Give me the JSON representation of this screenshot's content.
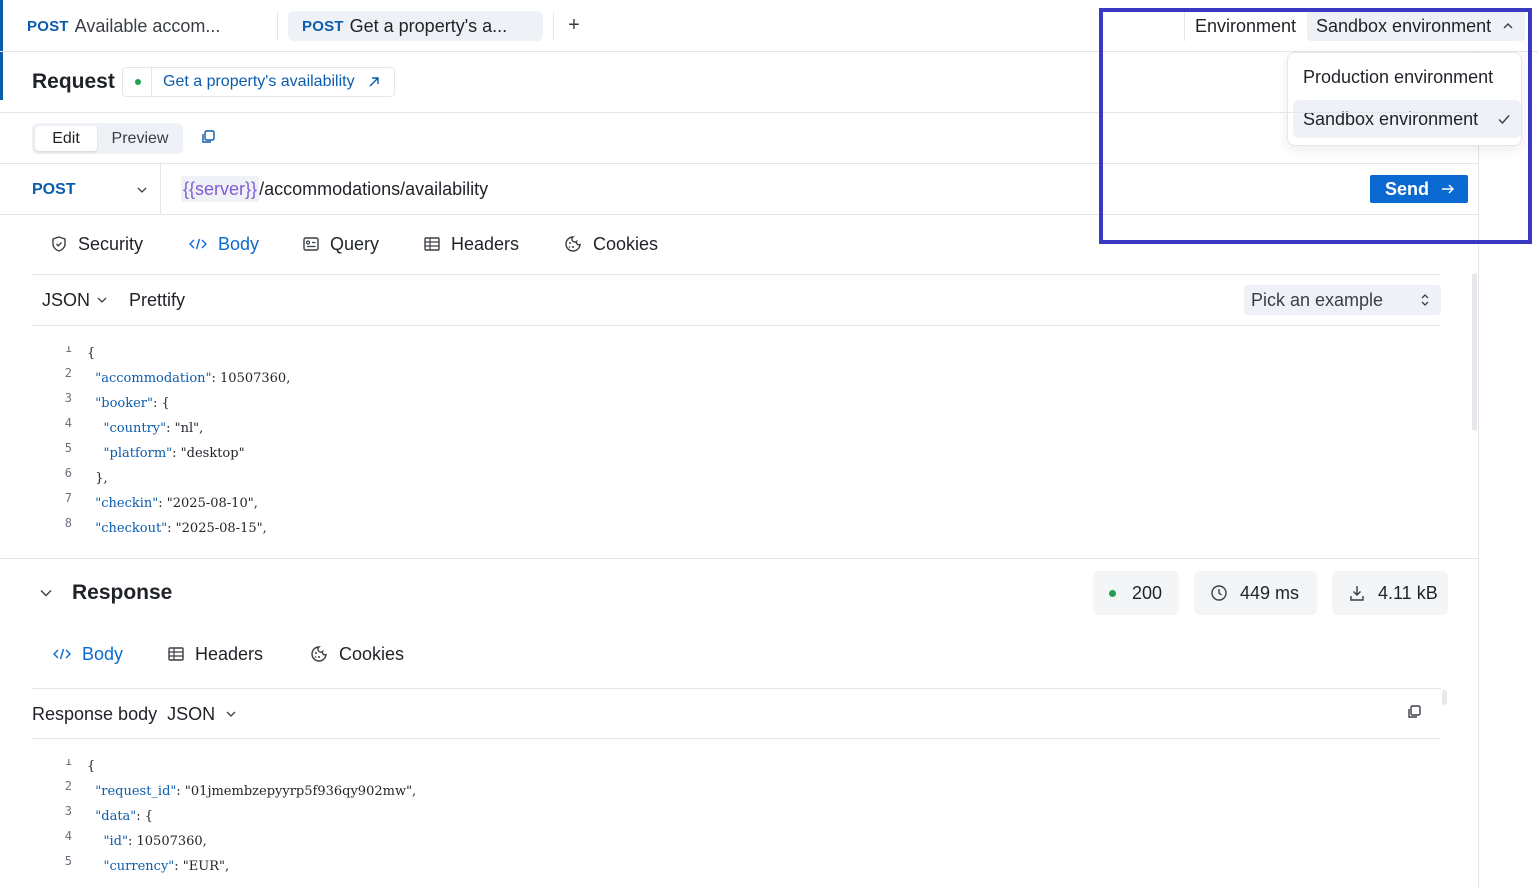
{
  "tabs": [
    {
      "method": "POST",
      "label": "Available accom..."
    },
    {
      "method": "POST",
      "label": "Get a property's a..."
    }
  ],
  "tab_add_label": "+",
  "environment": {
    "label": "Environment",
    "selected": "Sandbox environment",
    "options": [
      "Production environment",
      "Sandbox environment"
    ]
  },
  "request": {
    "title": "Request",
    "link_label": "Get a property's availability",
    "mode_tabs": [
      "Edit",
      "Preview"
    ],
    "method": "POST",
    "url_var": "{{server}}",
    "url_path": "/accommodations/availability",
    "send_label": "Send",
    "sub_tabs": [
      "Security",
      "Body",
      "Query",
      "Headers",
      "Cookies"
    ],
    "format": "JSON",
    "prettify": "Prettify",
    "pick_example": "Pick an example",
    "code_lines": [
      {
        "n": "1",
        "text": "{"
      },
      {
        "n": "2",
        "text": "  \"accommodation\": 10507360,"
      },
      {
        "n": "3",
        "text": "  \"booker\": {"
      },
      {
        "n": "4",
        "text": "    \"country\": \"nl\","
      },
      {
        "n": "5",
        "text": "    \"platform\": \"desktop\""
      },
      {
        "n": "6",
        "text": "  },"
      },
      {
        "n": "7",
        "text": "  \"checkin\": \"2025-08-10\","
      },
      {
        "n": "8",
        "text": "  \"checkout\": \"2025-08-15\","
      }
    ]
  },
  "response": {
    "title": "Response",
    "status": "200",
    "time": "449 ms",
    "size": "4.11 kB",
    "sub_tabs": [
      "Body",
      "Headers",
      "Cookies"
    ],
    "body_label": "Response body",
    "format": "JSON",
    "code_lines": [
      {
        "n": "1",
        "text": "{"
      },
      {
        "n": "2",
        "text": "  \"request_id\": \"01jmembzepyyrp5f936qy902mw\","
      },
      {
        "n": "3",
        "text": "  \"data\": {"
      },
      {
        "n": "4",
        "text": "    \"id\": 10507360,"
      },
      {
        "n": "5",
        "text": "    \"currency\": \"EUR\","
      }
    ]
  },
  "colors": {
    "accent": "#0b6ad1",
    "method": "#0b5cad",
    "number": "#e0553d",
    "variable": "#7f5bd6",
    "status_ok": "#20a050",
    "highlight_border": "#3b38c4"
  }
}
